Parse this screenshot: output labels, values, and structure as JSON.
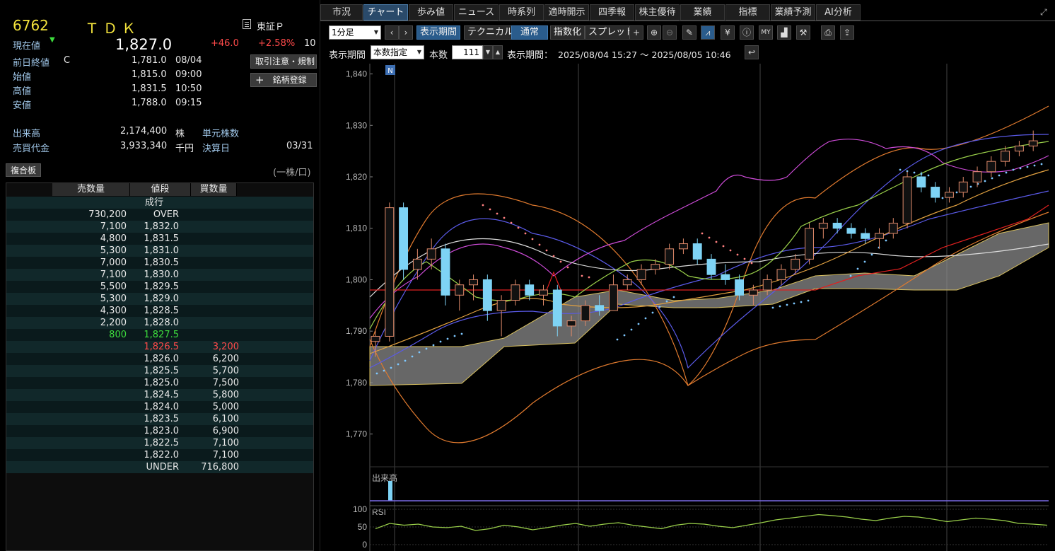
{
  "stock": {
    "code": "6762",
    "name": "ＴＤＫ",
    "market": "東証Ｐ",
    "current_label": "現在値",
    "current_price": "1,827.0",
    "change": "+46.0",
    "change_pct": "+2.58%",
    "change_pct_tail": "10",
    "prev_close_label": "前日終値",
    "prev_close_flag": "C",
    "prev_close": "1,781.0",
    "prev_close_date": "08/04",
    "open_label": "始値",
    "open": "1,815.0",
    "open_time": "09:00",
    "high_label": "高値",
    "high": "1,831.5",
    "high_time": "10:50",
    "low_label": "安値",
    "low": "1,788.0",
    "low_time": "09:15",
    "volume_label": "出来高",
    "volume": "2,174,400",
    "volume_unit": "株",
    "unit_shares_label": "単元株数",
    "turnover_label": "売買代金",
    "turnover": "3,933,340",
    "turnover_unit": "千円",
    "fiscal_label": "決算日",
    "fiscal_date": "03/31",
    "notice_button": "取引注意・規制",
    "register_button": "銘柄登録"
  },
  "board": {
    "tab_label": "複合板",
    "unit_note": "(一株/口)",
    "headers": [
      "売数量",
      "値段",
      "買数量"
    ],
    "market_order": "成行",
    "rows": [
      {
        "sell": "730,200",
        "price": "OVER",
        "buy": ""
      },
      {
        "sell": "7,100",
        "price": "1,832.0",
        "buy": ""
      },
      {
        "sell": "4,800",
        "price": "1,831.5",
        "buy": ""
      },
      {
        "sell": "5,300",
        "price": "1,831.0",
        "buy": ""
      },
      {
        "sell": "7,000",
        "price": "1,830.5",
        "buy": ""
      },
      {
        "sell": "7,100",
        "price": "1,830.0",
        "buy": ""
      },
      {
        "sell": "5,500",
        "price": "1,829.5",
        "buy": ""
      },
      {
        "sell": "5,300",
        "price": "1,829.0",
        "buy": ""
      },
      {
        "sell": "4,300",
        "price": "1,828.5",
        "buy": ""
      },
      {
        "sell": "2,200",
        "price": "1,828.0",
        "buy": ""
      },
      {
        "sell": "800",
        "price": "1,827.5",
        "buy": "",
        "highlight": "green"
      },
      {
        "sell": "",
        "price": "1,826.5",
        "buy": "3,200",
        "highlight": "red"
      },
      {
        "sell": "",
        "price": "1,826.0",
        "buy": "6,200"
      },
      {
        "sell": "",
        "price": "1,825.5",
        "buy": "5,700"
      },
      {
        "sell": "",
        "price": "1,825.0",
        "buy": "7,500"
      },
      {
        "sell": "",
        "price": "1,824.5",
        "buy": "5,800"
      },
      {
        "sell": "",
        "price": "1,824.0",
        "buy": "5,000"
      },
      {
        "sell": "",
        "price": "1,823.5",
        "buy": "6,100"
      },
      {
        "sell": "",
        "price": "1,823.0",
        "buy": "6,900"
      },
      {
        "sell": "",
        "price": "1,822.5",
        "buy": "7,100"
      },
      {
        "sell": "",
        "price": "1,822.0",
        "buy": "7,100"
      },
      {
        "sell": "",
        "price": "UNDER",
        "buy": "716,800"
      }
    ]
  },
  "tabs": [
    "市況",
    "チャート",
    "歩み値",
    "ニュース",
    "時系列",
    "適時開示",
    "四季報",
    "株主優待",
    "業績",
    "指標",
    "業績予測",
    "AI分析"
  ],
  "active_tab": "チャート",
  "toolbar": {
    "interval": "1分足",
    "period_button": "表示期間",
    "technical_button": "テクニカル",
    "normal_button": "通常",
    "index_button": "指数化",
    "spread_button": "スプレッド",
    "period_label": "表示期間",
    "period_mode": "本数指定",
    "count_label": "本数",
    "count_value": "111",
    "range_label": "表示期間：",
    "range_value": "2025/08/04 15:27 ～ 2025/08/05 10:46"
  },
  "chart_data": {
    "type": "line",
    "title": "",
    "ylim": [
      1765,
      1842
    ],
    "y_ticks": [
      "1,840",
      "1,830",
      "1,820",
      "1,810",
      "1,800",
      "1,790",
      "1,780",
      "1,770"
    ],
    "news_marker": "N",
    "volume_label": "出来高",
    "rsi_label": "RSI",
    "rsi_ticks": [
      "100",
      "50",
      "0"
    ],
    "candles": [
      [
        1788,
        1790,
        1785,
        1789
      ],
      [
        1789,
        1815,
        1788,
        1814
      ],
      [
        1814,
        1815,
        1800,
        1802
      ],
      [
        1802,
        1806,
        1800,
        1804
      ],
      [
        1804,
        1808,
        1802,
        1806
      ],
      [
        1806,
        1807,
        1795,
        1797
      ],
      [
        1797,
        1800,
        1794,
        1799
      ],
      [
        1799,
        1801,
        1796,
        1800
      ],
      [
        1800,
        1801,
        1792,
        1794
      ],
      [
        1794,
        1797,
        1789,
        1796
      ],
      [
        1796,
        1800,
        1795,
        1799
      ],
      [
        1799,
        1800,
        1796,
        1797
      ],
      [
        1797,
        1799,
        1795,
        1798
      ],
      [
        1798,
        1799,
        1789,
        1791
      ],
      [
        1791,
        1793,
        1789,
        1792
      ],
      [
        1792,
        1796,
        1791,
        1795
      ],
      [
        1795,
        1797,
        1793,
        1794
      ],
      [
        1794,
        1801,
        1794,
        1799
      ],
      [
        1799,
        1801,
        1798,
        1800
      ],
      [
        1800,
        1803,
        1799,
        1802
      ],
      [
        1802,
        1804,
        1801,
        1803
      ],
      [
        1803,
        1807,
        1802,
        1806
      ],
      [
        1806,
        1808,
        1805,
        1807
      ],
      [
        1807,
        1808,
        1803,
        1804
      ],
      [
        1804,
        1805,
        1800,
        1801
      ],
      [
        1801,
        1803,
        1799,
        1800
      ],
      [
        1800,
        1801,
        1796,
        1797
      ],
      [
        1797,
        1799,
        1795,
        1798
      ],
      [
        1798,
        1801,
        1797,
        1800
      ],
      [
        1800,
        1803,
        1799,
        1802
      ],
      [
        1802,
        1805,
        1801,
        1804
      ],
      [
        1804,
        1811,
        1803,
        1810
      ],
      [
        1810,
        1812,
        1808,
        1811
      ],
      [
        1811,
        1812,
        1809,
        1810
      ],
      [
        1810,
        1811,
        1808,
        1809
      ],
      [
        1809,
        1810,
        1807,
        1808
      ],
      [
        1808,
        1810,
        1806,
        1809
      ],
      [
        1809,
        1812,
        1808,
        1811
      ],
      [
        1811,
        1821,
        1810,
        1820
      ],
      [
        1820,
        1821,
        1817,
        1818
      ],
      [
        1818,
        1819,
        1815,
        1816
      ],
      [
        1816,
        1818,
        1815,
        1817
      ],
      [
        1817,
        1820,
        1816,
        1819
      ],
      [
        1819,
        1822,
        1818,
        1821
      ],
      [
        1821,
        1824,
        1820,
        1823
      ],
      [
        1823,
        1826,
        1822,
        1825
      ],
      [
        1825,
        1827,
        1824,
        1826
      ],
      [
        1826,
        1829,
        1825,
        1827
      ]
    ],
    "rsi": [
      45,
      60,
      55,
      58,
      50,
      48,
      52,
      40,
      45,
      55,
      50,
      42,
      48,
      55,
      60,
      52,
      58,
      62,
      55,
      50,
      45,
      55,
      60,
      58,
      52,
      48,
      55,
      62,
      70,
      75,
      80,
      85,
      82,
      78,
      72,
      68,
      75,
      80,
      78,
      72,
      65,
      70,
      75,
      72,
      68,
      60,
      58,
      55
    ]
  }
}
